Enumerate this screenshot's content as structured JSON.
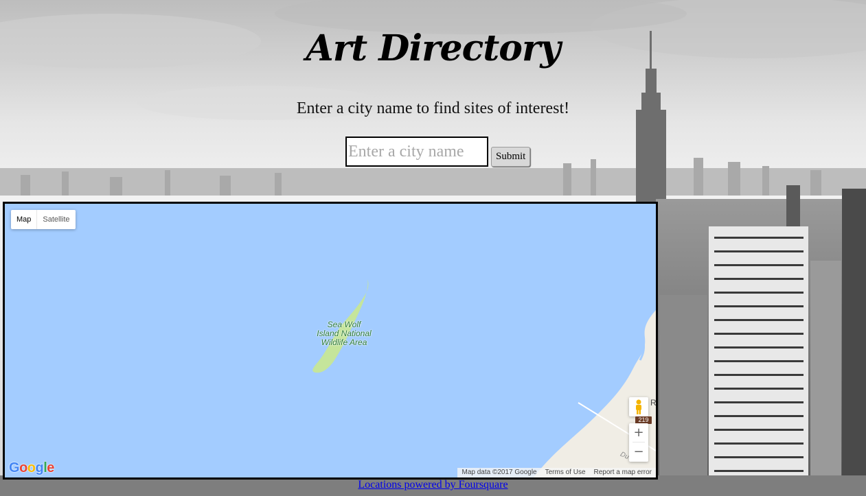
{
  "header": {
    "title": "Art Directory",
    "subtitle": "Enter a city name to find sites of interest!"
  },
  "search": {
    "placeholder": "Enter a city name",
    "value": "",
    "submit_label": "Submit"
  },
  "map": {
    "type_options": [
      "Map",
      "Satellite"
    ],
    "active_type": "Map",
    "island_label": "Sea Wolf Island National Wildlife Area",
    "island_label_lines": [
      "Sea Wolf",
      "Island National",
      "Wildlife Area"
    ],
    "shore_letter": "R",
    "road_label": "Du",
    "route_shield": "219",
    "zoom_in": "+",
    "zoom_out": "−",
    "logo_text": "Google",
    "attribution": {
      "map_data": "Map data ©2017 Google",
      "terms": "Terms of Use",
      "report": "Report a map error"
    },
    "colors": {
      "water": "#a3ccff",
      "land": "#f0ede5",
      "park": "#c5e59b"
    }
  },
  "footer": {
    "powered_by_text": "Locations powered by Foursquare"
  }
}
